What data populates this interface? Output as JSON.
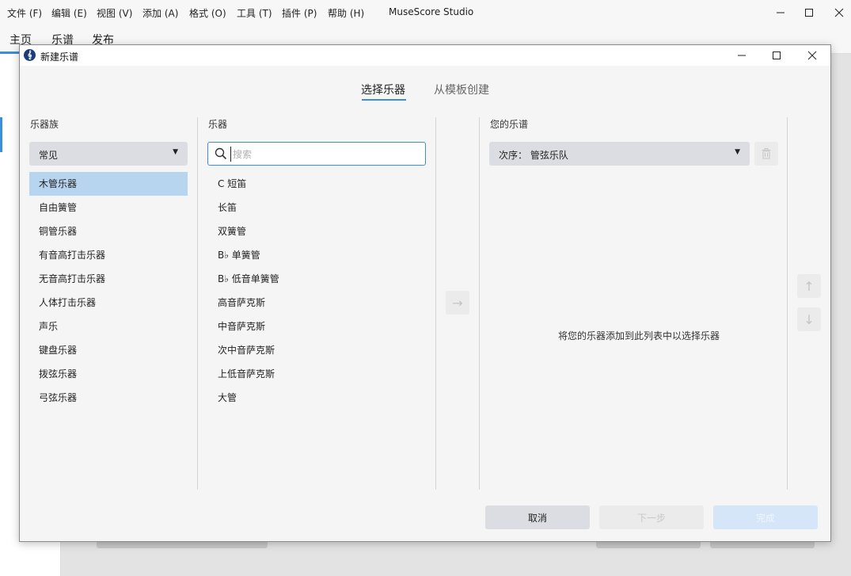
{
  "app": {
    "title": "MuseScore Studio",
    "menu": [
      "文件 (F)",
      "编辑 (E)",
      "视图 (V)",
      "添加 (A)",
      "格式 (O)",
      "工具 (T)",
      "插件 (P)",
      "帮助 (H)"
    ],
    "tabs": [
      "主页",
      "乐谱",
      "发布"
    ],
    "active_tab": "主页"
  },
  "dialog": {
    "title": "新建乐谱",
    "logo_glyph": "𝄞",
    "mode_tabs": [
      "选择乐器",
      "从模板创建"
    ],
    "active_mode_tab": "选择乐器",
    "families": {
      "heading": "乐器族",
      "selected_group": "常见",
      "items": [
        "木管乐器",
        "自由簧管",
        "铜管乐器",
        "有音高打击乐器",
        "无音高打击乐器",
        "人体打击乐器",
        "声乐",
        "键盘乐器",
        "拨弦乐器",
        "弓弦乐器"
      ],
      "selected_item": "木管乐器"
    },
    "instruments": {
      "heading": "乐器",
      "search_placeholder": "搜索",
      "search_value": "",
      "items": [
        "C 短笛",
        "长笛",
        "双簧管",
        "B♭ 单簧管",
        "B♭ 低音单簧管",
        "高音萨克斯",
        "中音萨克斯",
        "次中音萨克斯",
        "上低音萨克斯",
        "大管"
      ]
    },
    "add_arrow_glyph": "→",
    "score": {
      "heading": "您的乐谱",
      "order_label": "次序：  管弦乐队",
      "empty_hint": "将您的乐器添加到此列表中以选择乐器",
      "move_up_glyph": "↑",
      "move_down_glyph": "↓",
      "delete_icon": "trash-icon"
    },
    "buttons": {
      "cancel": "取消",
      "next": "下一步",
      "finish": "完成"
    }
  },
  "colors": {
    "accent": "#3b8ed8",
    "selected_row": "#b8d5f0",
    "dialog_bg": "#f5f5f5"
  }
}
